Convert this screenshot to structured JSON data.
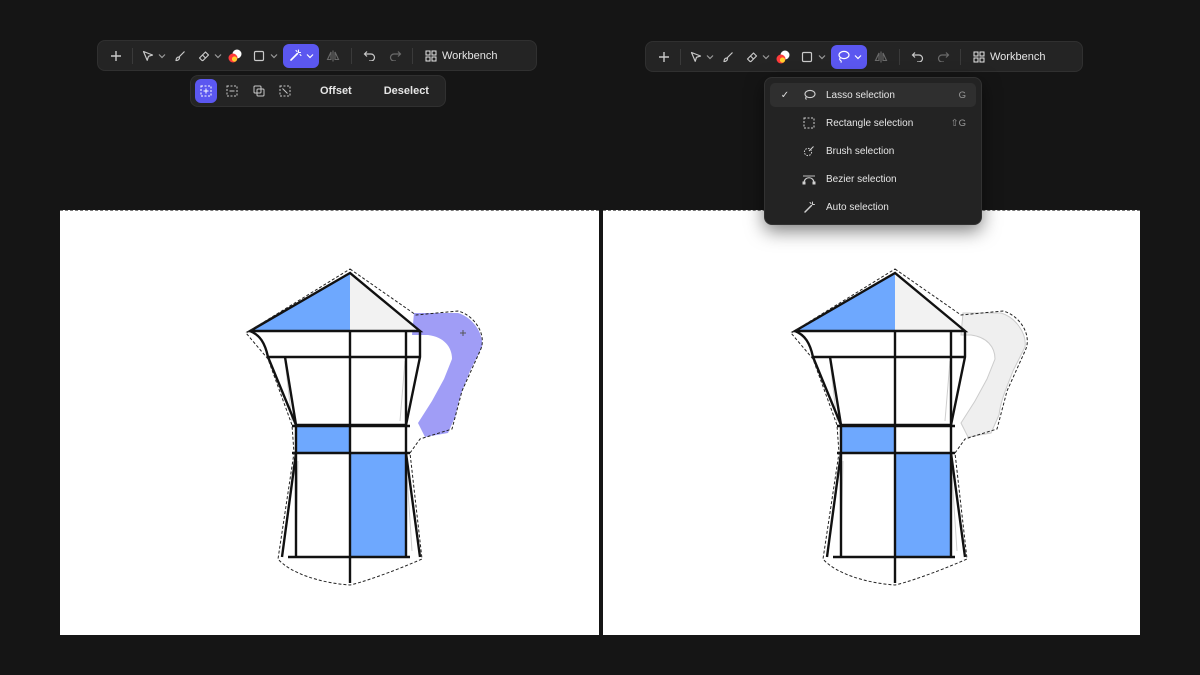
{
  "left": {
    "toolbar": {
      "workbench_label": "Workbench"
    },
    "subbar": {
      "offset_label": "Offset",
      "deselect_label": "Deselect"
    }
  },
  "right": {
    "toolbar": {
      "workbench_label": "Workbench"
    },
    "selection_menu": {
      "items": [
        {
          "label": "Lasso selection",
          "shortcut": "G",
          "checked": true,
          "icon": "lasso-icon"
        },
        {
          "label": "Rectangle selection",
          "shortcut": "⇧G",
          "checked": false,
          "icon": "rectangle-select-icon"
        },
        {
          "label": "Brush selection",
          "shortcut": "",
          "checked": false,
          "icon": "brush-select-icon"
        },
        {
          "label": "Bezier selection",
          "shortcut": "",
          "checked": false,
          "icon": "bezier-icon"
        },
        {
          "label": "Auto selection",
          "shortcut": "",
          "checked": false,
          "icon": "magic-wand-icon"
        }
      ]
    }
  },
  "colors": {
    "accent": "#5b57f0",
    "fill_blue": "#6ea8fe",
    "handle_purple": "#8f8cf5",
    "background": "#151515"
  }
}
